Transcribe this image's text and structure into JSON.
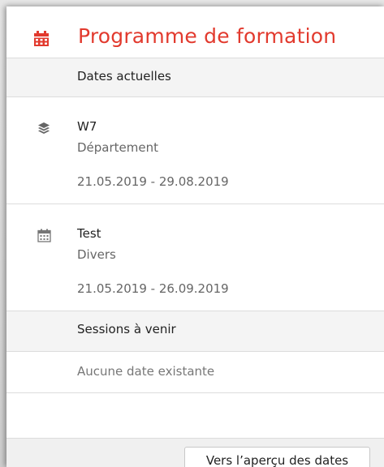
{
  "header": {
    "title": "Programme de formation",
    "icon": "calendar-icon",
    "accent": "#e23a2e"
  },
  "current": {
    "label": "Dates actuelles",
    "items": [
      {
        "name": "W7",
        "category": "Département",
        "dates": "21.05.2019 - 29.08.2019",
        "icon": "layers-icon"
      },
      {
        "name": "Test",
        "category": "Divers",
        "dates": "21.05.2019 - 26.09.2019",
        "icon": "calendar-small-icon"
      }
    ]
  },
  "upcoming": {
    "label": "Sessions à venir",
    "empty_text": "Aucune date existante"
  },
  "footer": {
    "button_label": "Vers l’aperçu des dates"
  }
}
